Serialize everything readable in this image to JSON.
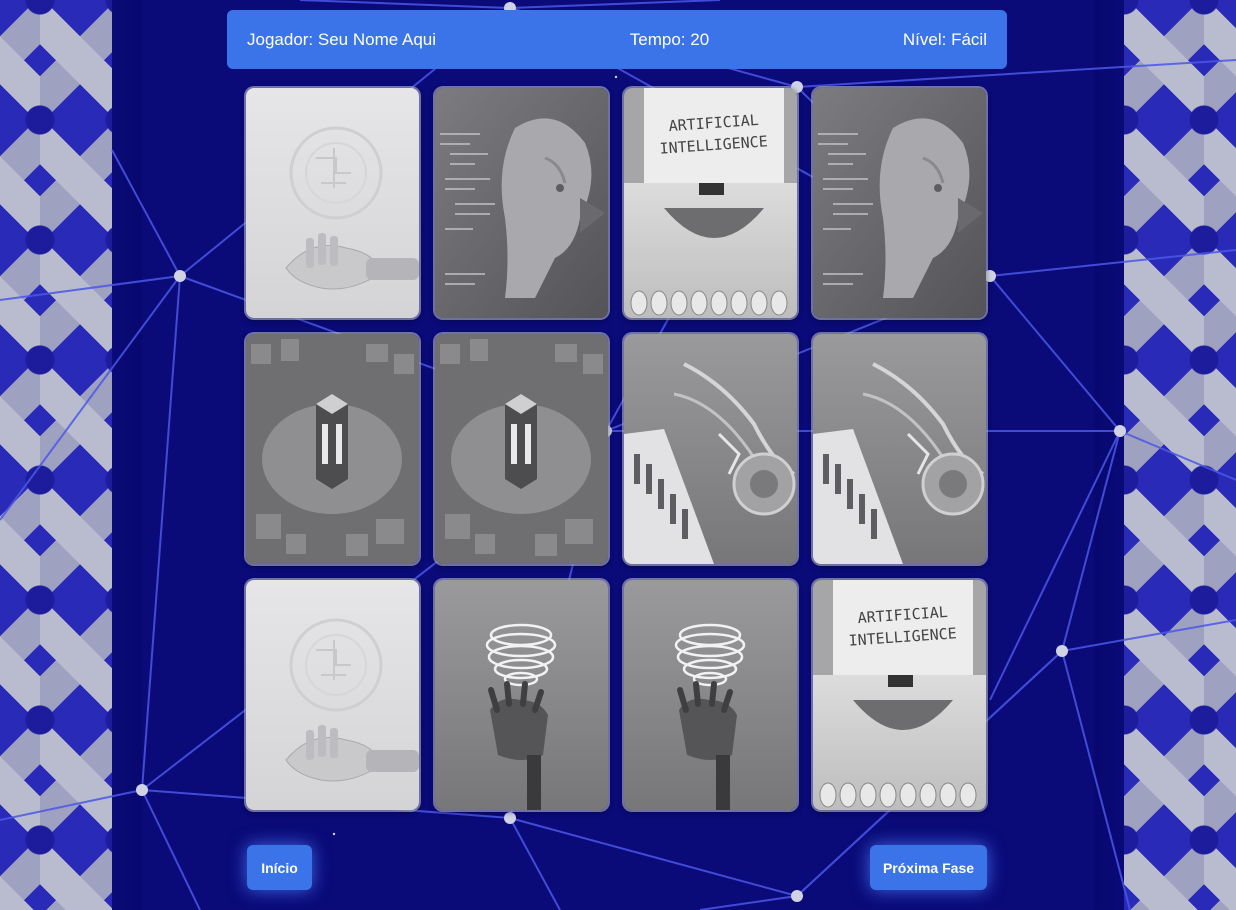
{
  "header": {
    "player": "Jogador: Seu Nome Aqui",
    "time": "Tempo: 20",
    "level": "Nível: Fácil"
  },
  "buttons": {
    "start": "Início",
    "next": "Próxima Fase"
  },
  "cards": [
    {
      "image": "robot-hand-brain-light"
    },
    {
      "image": "robot-face-code"
    },
    {
      "image": "typewriter-ai"
    },
    {
      "image": "robot-face-code"
    },
    {
      "image": "glowing-cube-city"
    },
    {
      "image": "glowing-cube-city"
    },
    {
      "image": "robot-arms-keyboard"
    },
    {
      "image": "robot-arms-keyboard"
    },
    {
      "image": "robot-hand-brain-light"
    },
    {
      "image": "robot-hand-neon-brain"
    },
    {
      "image": "robot-hand-neon-brain"
    },
    {
      "image": "typewriter-ai"
    }
  ],
  "card_texts": {
    "typewriter_line1": "ARTIFICIAL",
    "typewriter_line2": "INTELLIGENCE"
  },
  "colors": {
    "background": "#0a0a78",
    "accent": "#3b73e8",
    "network_lines": "#4b57e8"
  }
}
